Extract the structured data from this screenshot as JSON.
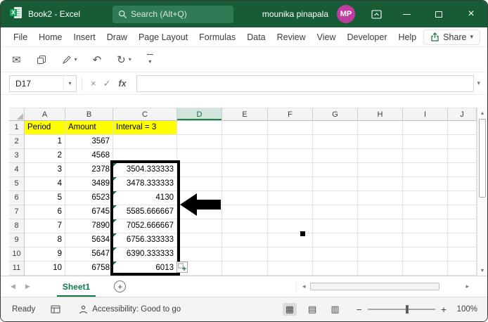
{
  "window": {
    "title": "Book2 - Excel"
  },
  "title_bar": {
    "search_placeholder": "Search (Alt+Q)",
    "user_name": "mounika pinapala",
    "avatar_initials": "MP"
  },
  "menu_bar": {
    "items": [
      "File",
      "Home",
      "Insert",
      "Draw",
      "Page Layout",
      "Formulas",
      "Data",
      "Review",
      "View",
      "Developer",
      "Help"
    ],
    "share_label": "Share"
  },
  "formula_bar": {
    "name_box": "D17",
    "fx_label": "fx",
    "formula_value": ""
  },
  "sheet": {
    "col_headers": [
      "A",
      "B",
      "C",
      "D",
      "E",
      "F",
      "G",
      "H",
      "I",
      "J"
    ],
    "selected_col_index": 3,
    "rows": [
      {
        "n": "1",
        "a": "Period",
        "b": "Amount",
        "c": "Interval = 3",
        "yellow": true
      },
      {
        "n": "2",
        "a": "1",
        "b": "3567",
        "c": ""
      },
      {
        "n": "3",
        "a": "2",
        "b": "4568",
        "c": ""
      },
      {
        "n": "4",
        "a": "3",
        "b": "2378",
        "c": "3504.333333",
        "err": true
      },
      {
        "n": "5",
        "a": "4",
        "b": "3489",
        "c": "3478.333333",
        "err": true
      },
      {
        "n": "6",
        "a": "5",
        "b": "6523",
        "c": "4130",
        "err": true
      },
      {
        "n": "7",
        "a": "6",
        "b": "6745",
        "c": "5585.666667",
        "err": true
      },
      {
        "n": "8",
        "a": "7",
        "b": "7890",
        "c": "7052.666667",
        "err": true
      },
      {
        "n": "9",
        "a": "8",
        "b": "5634",
        "c": "6756.333333",
        "err": true
      },
      {
        "n": "10",
        "a": "9",
        "b": "5647",
        "c": "6390.333333",
        "err": true
      },
      {
        "n": "11",
        "a": "10",
        "b": "6758",
        "c": "6013",
        "err": true
      }
    ]
  },
  "tabs": {
    "active": "Sheet1"
  },
  "status_bar": {
    "mode": "Ready",
    "accessibility": "Accessibility: Good to go",
    "zoom_level": "100%"
  },
  "icons": {
    "chevron_down": "▾",
    "close": "×",
    "cancel": "×",
    "check": "✓",
    "email": "✉",
    "undo": "↶",
    "redo": "↻",
    "add_sheet": "+",
    "nav_left": "◀",
    "nav_right": "▶",
    "scroll_left": "◂",
    "scroll_right": "▸",
    "scroll_up": "▴",
    "scroll_down": "▾",
    "view_normal": "▦",
    "view_page_layout": "▤",
    "view_page_break": "▥",
    "zoom_out": "−",
    "zoom_in": "+"
  },
  "colors": {
    "title_bar_green": "#185C37",
    "accent_green": "#107C41",
    "highlight_yellow": "#FFFF00",
    "avatar_magenta": "#BE3D9E"
  }
}
